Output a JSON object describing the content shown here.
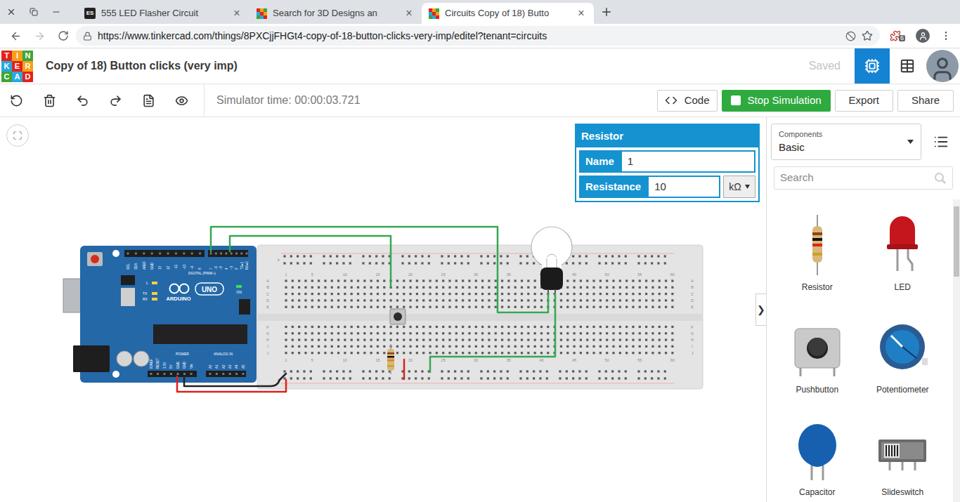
{
  "browser": {
    "tabs": [
      {
        "favicon": {
          "kind": "text",
          "text": "ES"
        },
        "label": "555 LED Flasher Circuit",
        "close": "×",
        "selected": false
      },
      {
        "favicon": {
          "kind": "tinkercad",
          "text": ""
        },
        "label": "Search for 3D Designs an",
        "close": "×",
        "selected": false
      },
      {
        "favicon": {
          "kind": "tinkercad",
          "text": ""
        },
        "label": "Circuits Copy of 18) Butto",
        "close": "×",
        "selected": true
      }
    ],
    "url": "https://www.tinkercad.com/things/8PXCjjFHGt4-copy-of-18-button-clicks-very-imp/editel?tenant=circuits",
    "extension_badge": "6"
  },
  "app": {
    "logo": [
      {
        "letter": "T",
        "color": "#e2231a"
      },
      {
        "letter": "I",
        "color": "#f6a01a"
      },
      {
        "letter": "N",
        "color": "#3fa535"
      },
      {
        "letter": "K",
        "color": "#27a9e1"
      },
      {
        "letter": "E",
        "color": "#e2231a"
      },
      {
        "letter": "R",
        "color": "#f6a01a"
      },
      {
        "letter": "C",
        "color": "#3fa535"
      },
      {
        "letter": "A",
        "color": "#27a9e1"
      },
      {
        "letter": "D",
        "color": "#e2231a"
      }
    ],
    "title": "Copy of 18) Button clicks (very imp)",
    "save_status": "Saved",
    "views": [
      {
        "name": "circuit",
        "selected": true
      },
      {
        "name": "list",
        "selected": false
      }
    ]
  },
  "toolbar": {
    "simulator_time": "Simulator time: 00:00:03.721",
    "buttons": [
      {
        "label": "Code",
        "kind": "code"
      },
      {
        "label": "Stop Simulation",
        "kind": "stop"
      },
      {
        "label": "Export",
        "kind": "plain"
      },
      {
        "label": "Share",
        "kind": "plain"
      }
    ]
  },
  "inspector": {
    "title": "Resistor",
    "fields": [
      {
        "label": "Name",
        "value": "1",
        "unit": ""
      },
      {
        "label": "Resistance",
        "value": "10",
        "unit": "kΩ"
      }
    ]
  },
  "circuit": {
    "arduino": {
      "brand": "ARDUINO",
      "model": "UNO",
      "power_led": "ON",
      "led_label": "L",
      "tx": "TX",
      "rx": "RX",
      "digital_heading": "DIGITAL (PWM~)",
      "power_heading": "POWER",
      "analog_heading": "ANALOG IN",
      "digital_pins": [
        "SCL",
        "SDA",
        "AREF",
        "GND",
        "13",
        "12",
        "~11",
        "~10",
        "~9",
        "8",
        "7",
        "~6",
        "~5",
        "4",
        "~3",
        "2",
        "TX▸1",
        "RX◂0"
      ],
      "power_pins": [
        "IOREF",
        "RESET",
        "3.3V",
        "5V",
        "GND",
        "GND",
        "Vin"
      ],
      "analog_pins": [
        "A0",
        "A1",
        "A2",
        "A3",
        "A4",
        "A5"
      ]
    },
    "breadboard": {
      "columns": [
        "1",
        "5",
        "10",
        "15",
        "20",
        "25",
        "30",
        "35",
        "40",
        "45",
        "50",
        "55",
        "60"
      ],
      "rows": [
        "A",
        "B",
        "C",
        "D",
        "E",
        "F",
        "G",
        "H",
        "I",
        "J"
      ],
      "rail_sign": "+"
    },
    "bulb": {
      "lit": false
    }
  },
  "panel": {
    "heading": "Components",
    "selected": "Basic",
    "search_placeholder": "Search",
    "collapse": "❯",
    "components": [
      {
        "label": "Resistor",
        "kind": "resistor"
      },
      {
        "label": "LED",
        "kind": "led"
      },
      {
        "label": "Pushbutton",
        "kind": "pushbutton"
      },
      {
        "label": "Potentiometer",
        "kind": "potentiometer"
      },
      {
        "label": "Capacitor",
        "kind": "capacitor"
      },
      {
        "label": "Slideswitch",
        "kind": "slideswitch"
      }
    ]
  }
}
